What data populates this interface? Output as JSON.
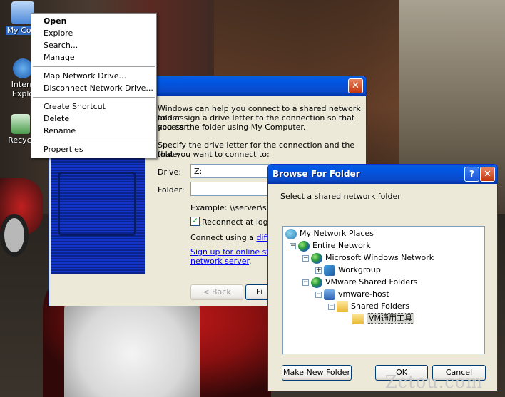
{
  "desktop": {
    "icons": [
      {
        "label": "My Com"
      },
      {
        "label": "Intern"
      },
      {
        "label": "Explo"
      },
      {
        "label": "Recycl"
      }
    ]
  },
  "context_menu": {
    "items": [
      {
        "label": "Open",
        "bold": true
      },
      {
        "label": "Explore"
      },
      {
        "label": "Search..."
      },
      {
        "label": "Manage"
      },
      {
        "label": "Map Network Drive..."
      },
      {
        "label": "Disconnect Network Drive..."
      },
      {
        "label": "Create Shortcut"
      },
      {
        "label": "Delete"
      },
      {
        "label": "Rename"
      },
      {
        "label": "Properties"
      }
    ]
  },
  "map_drive": {
    "close_label": "✕",
    "intro_1": "Windows can help you connect to a shared network folder",
    "intro_2": "and assign a drive letter to the connection so that you can",
    "intro_3": "access the folder using My Computer.",
    "specify_1": "Specify the drive letter for the connection and the folder",
    "specify_2": "that you want to connect to:",
    "drive_label": "Drive:",
    "drive_value": "Z:",
    "folder_label": "Folder:",
    "folder_value": "",
    "example": "Example: \\\\server\\sha",
    "reconnect_label": "Reconnect at logon",
    "connect_using_prefix": "Connect using a ",
    "connect_using_link": "differe",
    "signup_1": "Sign up for online stora",
    "signup_2": "network server",
    "signup_2_suffix": ".",
    "back_label": "< Back",
    "finish_label": "Fi"
  },
  "browse": {
    "title": "Browse For Folder",
    "help_label": "?",
    "close_label": "✕",
    "prompt": "Select a shared network folder",
    "tree": [
      {
        "label": "My Network Places"
      },
      {
        "label": "Entire Network"
      },
      {
        "label": "Microsoft Windows Network"
      },
      {
        "label": "Workgroup"
      },
      {
        "label": "VMware Shared Folders"
      },
      {
        "label": "vmware-host"
      },
      {
        "label": "Shared Folders"
      },
      {
        "label": "VM通用工具"
      }
    ],
    "new_folder_label": "Make New Folder",
    "ok_label": "OK",
    "cancel_label": "Cancel"
  },
  "watermark": "Zctou.com"
}
